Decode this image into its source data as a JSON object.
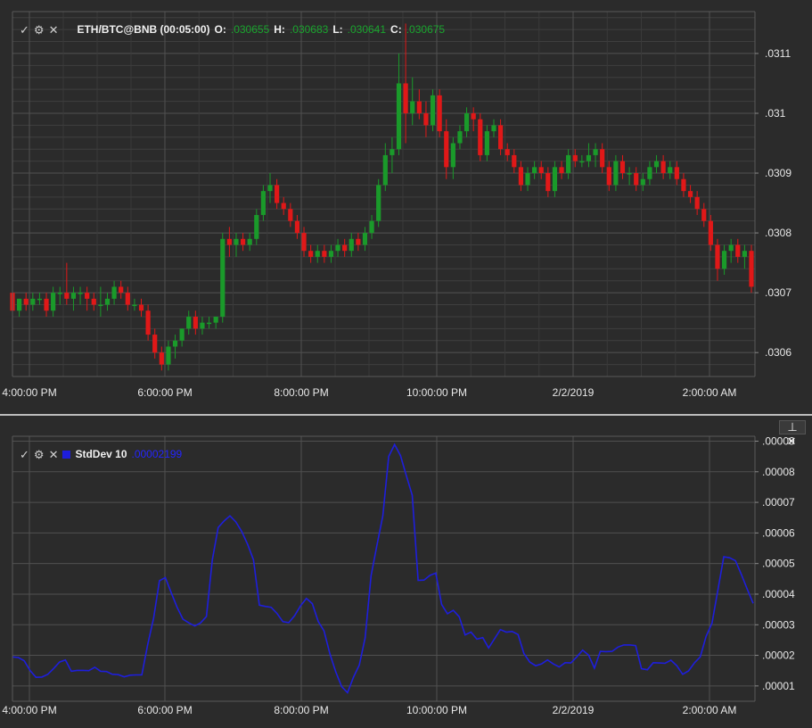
{
  "price_panel": {
    "icons": {
      "check": "check-icon",
      "gear": "gear-icon",
      "close": "close-icon"
    },
    "symbol": "ETH/BTC@BNB (00:05:00)",
    "open_label": "O:",
    "open_value": ".030655",
    "high_label": "H:",
    "high_value": ".030683",
    "low_label": "L:",
    "low_value": ".030641",
    "close_label": "C:",
    "close_value": ".030675"
  },
  "indicator_panel": {
    "icons": {
      "check": "check-icon",
      "gear": "gear-icon",
      "close": "close-icon",
      "pin": "pin-icon",
      "remove": "close-icon"
    },
    "name": "StdDev 10",
    "value": ".00002199",
    "color": "#1e1edc"
  },
  "colors": {
    "up": "#1a9a2a",
    "down": "#e01818",
    "value_green": "#1aa52e",
    "background": "#2b2b2b",
    "grid": "#505050"
  },
  "x_axis_labels": [
    "4:00:00 PM",
    "6:00:00 PM",
    "8:00:00 PM",
    "10:00:00 PM",
    "2/2/2019",
    "2:00:00 AM"
  ],
  "chart_data": [
    {
      "type": "candlestick",
      "title": "ETH/BTC@BNB (00:05:00)",
      "y_ticks": [
        ".0306",
        ".0307",
        ".0308",
        ".0309",
        ".031",
        ".0311"
      ],
      "ylim": [
        0.03056,
        0.03117
      ],
      "grid": true,
      "bar_interval_minutes": 5,
      "candles": [
        {
          "o": 0.0307,
          "h": 0.03071,
          "l": 0.03064,
          "c": 0.03067
        },
        {
          "o": 0.03067,
          "h": 0.03069,
          "l": 0.03066,
          "c": 0.03069
        },
        {
          "o": 0.03069,
          "h": 0.0307,
          "l": 0.03067,
          "c": 0.03068
        },
        {
          "o": 0.03068,
          "h": 0.0307,
          "l": 0.03067,
          "c": 0.03069
        },
        {
          "o": 0.03069,
          "h": 0.0307,
          "l": 0.03068,
          "c": 0.03069
        },
        {
          "o": 0.03069,
          "h": 0.0307,
          "l": 0.03066,
          "c": 0.03067
        },
        {
          "o": 0.03067,
          "h": 0.03071,
          "l": 0.03066,
          "c": 0.0307
        },
        {
          "o": 0.0307,
          "h": 0.03071,
          "l": 0.03068,
          "c": 0.0307
        },
        {
          "o": 0.0307,
          "h": 0.03075,
          "l": 0.03068,
          "c": 0.03069
        },
        {
          "o": 0.03069,
          "h": 0.03071,
          "l": 0.03067,
          "c": 0.0307
        },
        {
          "o": 0.0307,
          "h": 0.03071,
          "l": 0.03068,
          "c": 0.0307
        },
        {
          "o": 0.0307,
          "h": 0.03071,
          "l": 0.03067,
          "c": 0.03069
        },
        {
          "o": 0.03069,
          "h": 0.0307,
          "l": 0.03067,
          "c": 0.03068
        },
        {
          "o": 0.03068,
          "h": 0.03071,
          "l": 0.03066,
          "c": 0.03068
        },
        {
          "o": 0.03068,
          "h": 0.0307,
          "l": 0.03067,
          "c": 0.03069
        },
        {
          "o": 0.03069,
          "h": 0.03072,
          "l": 0.03068,
          "c": 0.03071
        },
        {
          "o": 0.03071,
          "h": 0.03072,
          "l": 0.03069,
          "c": 0.0307
        },
        {
          "o": 0.0307,
          "h": 0.03071,
          "l": 0.03067,
          "c": 0.03068
        },
        {
          "o": 0.03068,
          "h": 0.03069,
          "l": 0.03067,
          "c": 0.03068
        },
        {
          "o": 0.03068,
          "h": 0.03069,
          "l": 0.03066,
          "c": 0.03067
        },
        {
          "o": 0.03067,
          "h": 0.03068,
          "l": 0.03062,
          "c": 0.03063
        },
        {
          "o": 0.03063,
          "h": 0.03064,
          "l": 0.03059,
          "c": 0.0306
        },
        {
          "o": 0.0306,
          "h": 0.03061,
          "l": 0.03057,
          "c": 0.03058
        },
        {
          "o": 0.03058,
          "h": 0.03062,
          "l": 0.03057,
          "c": 0.03061
        },
        {
          "o": 0.03061,
          "h": 0.03063,
          "l": 0.03059,
          "c": 0.03062
        },
        {
          "o": 0.03062,
          "h": 0.03064,
          "l": 0.03061,
          "c": 0.03064
        },
        {
          "o": 0.03064,
          "h": 0.03067,
          "l": 0.03063,
          "c": 0.03066
        },
        {
          "o": 0.03066,
          "h": 0.03067,
          "l": 0.03063,
          "c": 0.03064
        },
        {
          "o": 0.03064,
          "h": 0.03066,
          "l": 0.03063,
          "c": 0.03065
        },
        {
          "o": 0.03065,
          "h": 0.03066,
          "l": 0.03064,
          "c": 0.03065
        },
        {
          "o": 0.03065,
          "h": 0.03066,
          "l": 0.03064,
          "c": 0.03066
        },
        {
          "o": 0.03066,
          "h": 0.0308,
          "l": 0.03065,
          "c": 0.03079
        },
        {
          "o": 0.03079,
          "h": 0.03081,
          "l": 0.03076,
          "c": 0.03078
        },
        {
          "o": 0.03078,
          "h": 0.0308,
          "l": 0.03076,
          "c": 0.03079
        },
        {
          "o": 0.03079,
          "h": 0.0308,
          "l": 0.03077,
          "c": 0.03078
        },
        {
          "o": 0.03078,
          "h": 0.0308,
          "l": 0.03077,
          "c": 0.03079
        },
        {
          "o": 0.03079,
          "h": 0.03084,
          "l": 0.03078,
          "c": 0.03083
        },
        {
          "o": 0.03083,
          "h": 0.03088,
          "l": 0.03082,
          "c": 0.03087
        },
        {
          "o": 0.03087,
          "h": 0.0309,
          "l": 0.03085,
          "c": 0.03088
        },
        {
          "o": 0.03088,
          "h": 0.03089,
          "l": 0.03084,
          "c": 0.03085
        },
        {
          "o": 0.03085,
          "h": 0.03086,
          "l": 0.03083,
          "c": 0.03084
        },
        {
          "o": 0.03084,
          "h": 0.03085,
          "l": 0.03081,
          "c": 0.03082
        },
        {
          "o": 0.03082,
          "h": 0.03083,
          "l": 0.03079,
          "c": 0.0308
        },
        {
          "o": 0.0308,
          "h": 0.03081,
          "l": 0.03076,
          "c": 0.03077
        },
        {
          "o": 0.03077,
          "h": 0.03078,
          "l": 0.03075,
          "c": 0.03076
        },
        {
          "o": 0.03076,
          "h": 0.03078,
          "l": 0.03075,
          "c": 0.03077
        },
        {
          "o": 0.03077,
          "h": 0.03078,
          "l": 0.03075,
          "c": 0.03076
        },
        {
          "o": 0.03076,
          "h": 0.03078,
          "l": 0.03075,
          "c": 0.03077
        },
        {
          "o": 0.03077,
          "h": 0.03079,
          "l": 0.03076,
          "c": 0.03078
        },
        {
          "o": 0.03078,
          "h": 0.03079,
          "l": 0.03076,
          "c": 0.03077
        },
        {
          "o": 0.03077,
          "h": 0.0308,
          "l": 0.03076,
          "c": 0.03079
        },
        {
          "o": 0.03079,
          "h": 0.0308,
          "l": 0.03077,
          "c": 0.03078
        },
        {
          "o": 0.03078,
          "h": 0.03081,
          "l": 0.03077,
          "c": 0.0308
        },
        {
          "o": 0.0308,
          "h": 0.03083,
          "l": 0.03079,
          "c": 0.03082
        },
        {
          "o": 0.03082,
          "h": 0.03089,
          "l": 0.03081,
          "c": 0.03088
        },
        {
          "o": 0.03088,
          "h": 0.03095,
          "l": 0.03087,
          "c": 0.03093
        },
        {
          "o": 0.03093,
          "h": 0.03096,
          "l": 0.0309,
          "c": 0.03094
        },
        {
          "o": 0.03094,
          "h": 0.0311,
          "l": 0.03093,
          "c": 0.03105
        },
        {
          "o": 0.03105,
          "h": 0.03115,
          "l": 0.03095,
          "c": 0.031
        },
        {
          "o": 0.031,
          "h": 0.03106,
          "l": 0.03098,
          "c": 0.03102
        },
        {
          "o": 0.03102,
          "h": 0.03104,
          "l": 0.03099,
          "c": 0.031
        },
        {
          "o": 0.031,
          "h": 0.03102,
          "l": 0.03096,
          "c": 0.03098
        },
        {
          "o": 0.03098,
          "h": 0.03104,
          "l": 0.03097,
          "c": 0.03103
        },
        {
          "o": 0.03103,
          "h": 0.03104,
          "l": 0.03096,
          "c": 0.03097
        },
        {
          "o": 0.03097,
          "h": 0.03099,
          "l": 0.03089,
          "c": 0.03091
        },
        {
          "o": 0.03091,
          "h": 0.03096,
          "l": 0.03089,
          "c": 0.03095
        },
        {
          "o": 0.03095,
          "h": 0.03098,
          "l": 0.03094,
          "c": 0.03097
        },
        {
          "o": 0.03097,
          "h": 0.03101,
          "l": 0.03096,
          "c": 0.031
        },
        {
          "o": 0.031,
          "h": 0.03101,
          "l": 0.03097,
          "c": 0.03099
        },
        {
          "o": 0.03099,
          "h": 0.031,
          "l": 0.03092,
          "c": 0.03093
        },
        {
          "o": 0.03093,
          "h": 0.03098,
          "l": 0.03092,
          "c": 0.03097
        },
        {
          "o": 0.03097,
          "h": 0.03099,
          "l": 0.03096,
          "c": 0.03098
        },
        {
          "o": 0.03098,
          "h": 0.03099,
          "l": 0.03093,
          "c": 0.03094
        },
        {
          "o": 0.03094,
          "h": 0.03095,
          "l": 0.03092,
          "c": 0.03093
        },
        {
          "o": 0.03093,
          "h": 0.03094,
          "l": 0.0309,
          "c": 0.03091
        },
        {
          "o": 0.03091,
          "h": 0.03092,
          "l": 0.03087,
          "c": 0.03088
        },
        {
          "o": 0.03088,
          "h": 0.03091,
          "l": 0.03087,
          "c": 0.0309
        },
        {
          "o": 0.0309,
          "h": 0.03092,
          "l": 0.03089,
          "c": 0.03091
        },
        {
          "o": 0.03091,
          "h": 0.03092,
          "l": 0.03089,
          "c": 0.0309
        },
        {
          "o": 0.0309,
          "h": 0.03091,
          "l": 0.03086,
          "c": 0.03087
        },
        {
          "o": 0.03087,
          "h": 0.03092,
          "l": 0.03086,
          "c": 0.03091
        },
        {
          "o": 0.03091,
          "h": 0.03092,
          "l": 0.03089,
          "c": 0.0309
        },
        {
          "o": 0.0309,
          "h": 0.03094,
          "l": 0.03089,
          "c": 0.03093
        },
        {
          "o": 0.03093,
          "h": 0.03094,
          "l": 0.03091,
          "c": 0.03092
        },
        {
          "o": 0.03092,
          "h": 0.03093,
          "l": 0.03091,
          "c": 0.03092
        },
        {
          "o": 0.03092,
          "h": 0.03095,
          "l": 0.03091,
          "c": 0.03093
        },
        {
          "o": 0.03093,
          "h": 0.03095,
          "l": 0.03091,
          "c": 0.03094
        },
        {
          "o": 0.03094,
          "h": 0.03095,
          "l": 0.0309,
          "c": 0.03091
        },
        {
          "o": 0.03091,
          "h": 0.03092,
          "l": 0.03087,
          "c": 0.03088
        },
        {
          "o": 0.03088,
          "h": 0.03093,
          "l": 0.03087,
          "c": 0.03092
        },
        {
          "o": 0.03092,
          "h": 0.03093,
          "l": 0.03089,
          "c": 0.0309
        },
        {
          "o": 0.0309,
          "h": 0.03091,
          "l": 0.03088,
          "c": 0.0309
        },
        {
          "o": 0.0309,
          "h": 0.03091,
          "l": 0.03087,
          "c": 0.03088
        },
        {
          "o": 0.03088,
          "h": 0.0309,
          "l": 0.03087,
          "c": 0.03089
        },
        {
          "o": 0.03089,
          "h": 0.03092,
          "l": 0.03088,
          "c": 0.03091
        },
        {
          "o": 0.03091,
          "h": 0.03093,
          "l": 0.0309,
          "c": 0.03092
        },
        {
          "o": 0.03092,
          "h": 0.03093,
          "l": 0.03089,
          "c": 0.0309
        },
        {
          "o": 0.0309,
          "h": 0.03092,
          "l": 0.03089,
          "c": 0.03091
        },
        {
          "o": 0.03091,
          "h": 0.03092,
          "l": 0.03088,
          "c": 0.03089
        },
        {
          "o": 0.03089,
          "h": 0.0309,
          "l": 0.03086,
          "c": 0.03087
        },
        {
          "o": 0.03087,
          "h": 0.03088,
          "l": 0.03085,
          "c": 0.03086
        },
        {
          "o": 0.03086,
          "h": 0.03087,
          "l": 0.03083,
          "c": 0.03084
        },
        {
          "o": 0.03084,
          "h": 0.03085,
          "l": 0.03081,
          "c": 0.03082
        },
        {
          "o": 0.03082,
          "h": 0.03083,
          "l": 0.03077,
          "c": 0.03078
        },
        {
          "o": 0.03078,
          "h": 0.03079,
          "l": 0.03072,
          "c": 0.03074
        },
        {
          "o": 0.03074,
          "h": 0.03078,
          "l": 0.03073,
          "c": 0.03077
        },
        {
          "o": 0.03077,
          "h": 0.03079,
          "l": 0.03075,
          "c": 0.03078
        },
        {
          "o": 0.03078,
          "h": 0.03079,
          "l": 0.03075,
          "c": 0.03076
        },
        {
          "o": 0.03076,
          "h": 0.03078,
          "l": 0.03074,
          "c": 0.03077
        },
        {
          "o": 0.03077,
          "h": 0.03078,
          "l": 0.0307,
          "c": 0.03071
        }
      ]
    },
    {
      "type": "line",
      "series": [
        {
          "name": "StdDev 10",
          "color": "#1e1edc",
          "values": [
            1.95e-05,
            1.93e-05,
            1.82e-05,
            1.5e-05,
            1.28e-05,
            1.29e-05,
            1.38e-05,
            1.57e-05,
            1.78e-05,
            1.85e-05,
            1.48e-05,
            1.51e-05,
            1.51e-05,
            1.5e-05,
            1.61e-05,
            1.48e-05,
            1.47e-05,
            1.38e-05,
            1.37e-05,
            1.3e-05,
            1.35e-05,
            1.36e-05,
            1.36e-05,
            2.35e-05,
            3.21e-05,
            4.44e-05,
            4.54e-05,
            4.05e-05,
            3.57e-05,
            3.18e-05,
            3.06e-05,
            2.96e-05,
            3.06e-05,
            3.27e-05,
            5.12e-05,
            6.18e-05,
            6.39e-05,
            6.56e-05,
            6.36e-05,
            6.05e-05,
            5.63e-05,
            5.12e-05,
            3.64e-05,
            3.6e-05,
            3.57e-05,
            3.37e-05,
            3.1e-05,
            3.07e-05,
            3.3e-05,
            3.62e-05,
            3.86e-05,
            3.69e-05,
            3.11e-05,
            2.8e-05,
            2.05e-05,
            1.46e-05,
            9.8e-06,
            7.8e-06,
            1.28e-05,
            1.68e-05,
            2.58e-05,
            4.6e-05,
            5.6e-05,
            6.56e-05,
            8.5e-05,
            8.89e-05,
            8.53e-05,
            7.87e-05,
            7.23e-05,
            4.45e-05,
            4.46e-05,
            4.61e-05,
            4.69e-05,
            3.66e-05,
            3.36e-05,
            3.47e-05,
            3.26e-05,
            2.67e-05,
            2.76e-05,
            2.53e-05,
            2.58e-05,
            2.24e-05,
            2.54e-05,
            2.84e-05,
            2.76e-05,
            2.78e-05,
            2.68e-05,
            2.06e-05,
            1.78e-05,
            1.66e-05,
            1.72e-05,
            1.85e-05,
            1.72e-05,
            1.62e-05,
            1.76e-05,
            1.75e-05,
            1.95e-05,
            2.17e-05,
            2.01e-05,
            1.58e-05,
            2.13e-05,
            2.12e-05,
            2.13e-05,
            2.27e-05,
            2.34e-05,
            2.34e-05,
            2.32e-05,
            1.56e-05,
            1.53e-05,
            1.76e-05,
            1.75e-05,
            1.74e-05,
            1.84e-05,
            1.66e-05,
            1.38e-05,
            1.49e-05,
            1.75e-05,
            1.95e-05,
            2.62e-05,
            3.05e-05,
            4.13e-05,
            5.22e-05,
            5.19e-05,
            5.09e-05,
            4.64e-05,
            4.16e-05,
            3.7e-05
          ]
        }
      ],
      "y_ticks": [
        ".00001",
        ".00002",
        ".00003",
        ".00004",
        ".00005",
        ".00006",
        ".00007",
        ".00008",
        ".00009"
      ],
      "ylim": [
        5e-06,
        9.16e-05
      ],
      "grid": true
    }
  ]
}
